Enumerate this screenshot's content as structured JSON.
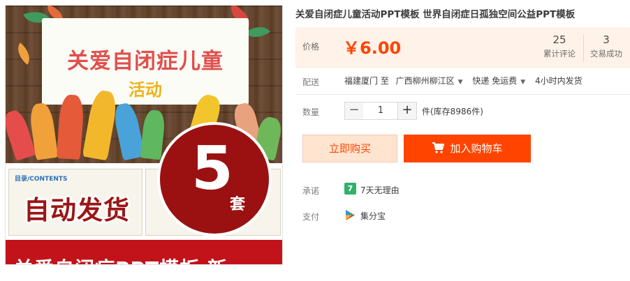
{
  "product": {
    "title": "关爱自闭症儿童活动PPT模板 世界自闭症日孤独空间公益PPT模板",
    "image": {
      "banner_title": "关爱自闭症儿童",
      "banner_subtitle": "活动",
      "slide_label": "目录/CONTENTS",
      "auto_ship": "自动发货",
      "badge_number": "5",
      "badge_unit": "套",
      "bottom_text": "关爱自闭症PPT模板 新"
    }
  },
  "price": {
    "label": "价格",
    "value": "￥6.00",
    "color": "#ff4400"
  },
  "stats": {
    "reviews_count": "25",
    "reviews_label": "累计评论",
    "trades_count": "3",
    "trades_label": "交易成功"
  },
  "shipping": {
    "label": "配送",
    "from": "福建厦门 至",
    "to": "广西柳州柳江区",
    "method": "快递 免运费",
    "dispatch": "4小时内发货"
  },
  "quantity": {
    "label": "数量",
    "value": "1",
    "minus": "−",
    "plus": "+",
    "stock": "件(库存8986件)"
  },
  "actions": {
    "buy_now": "立即购买",
    "add_to_cart": "加入购物车"
  },
  "promise": {
    "label": "承诺",
    "icon_text": "7",
    "text": "7天无理由"
  },
  "payment": {
    "label": "支付",
    "text": "集分宝"
  },
  "icons": {
    "cart": "cart-icon",
    "promise": "seven-day-icon",
    "payment": "jifenbao-icon",
    "caret": "caret-down-icon"
  }
}
